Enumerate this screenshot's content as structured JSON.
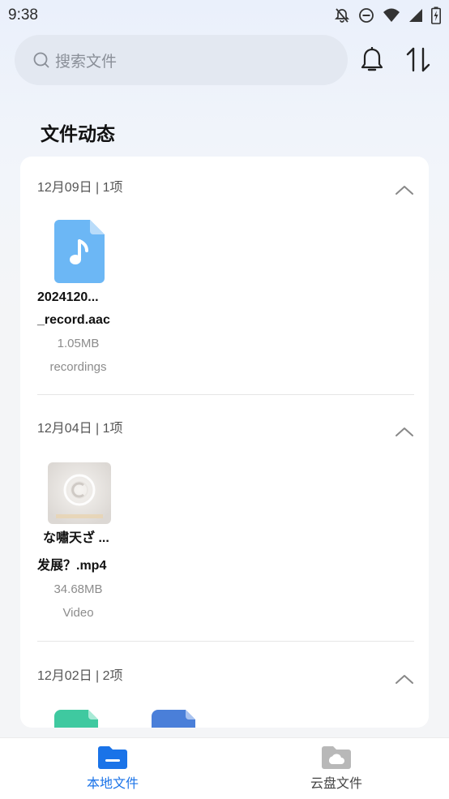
{
  "status_bar": {
    "time": "9:38",
    "icons": [
      "bell-off-icon",
      "dnd-icon",
      "wifi-icon",
      "signal-icon",
      "battery-charging-icon"
    ]
  },
  "search": {
    "placeholder": "搜索文件"
  },
  "header_icons": [
    "notification-bell-icon",
    "sort-icon"
  ],
  "section_title": "文件动态",
  "groups": [
    {
      "header": "12月09日 | 1项",
      "files": [
        {
          "name_line1": "2024120...",
          "name_line2": "_record.aac",
          "size": "1.05MB",
          "folder": "recordings",
          "icon": "audio-file-icon",
          "color": "#6cb7f5"
        }
      ]
    },
    {
      "header": "12月04日 | 1项",
      "files": [
        {
          "name_line1": "な嘯天ざ ...",
          "name_line2": "发展？.mp4",
          "size": "34.68MB",
          "folder": "Video",
          "icon": "video-thumbnail"
        }
      ]
    },
    {
      "header": "12月02日 | 2项",
      "files": [
        {
          "icon": "green-file-icon",
          "color": "#3fc9a0"
        },
        {
          "icon": "blue-file-icon",
          "color": "#4a7fd9"
        }
      ]
    }
  ],
  "bottom_nav": {
    "items": [
      {
        "label": "本地文件",
        "active": true,
        "color": "#1a73e8"
      },
      {
        "label": "云盘文件",
        "active": false,
        "color": "#444444"
      }
    ]
  }
}
